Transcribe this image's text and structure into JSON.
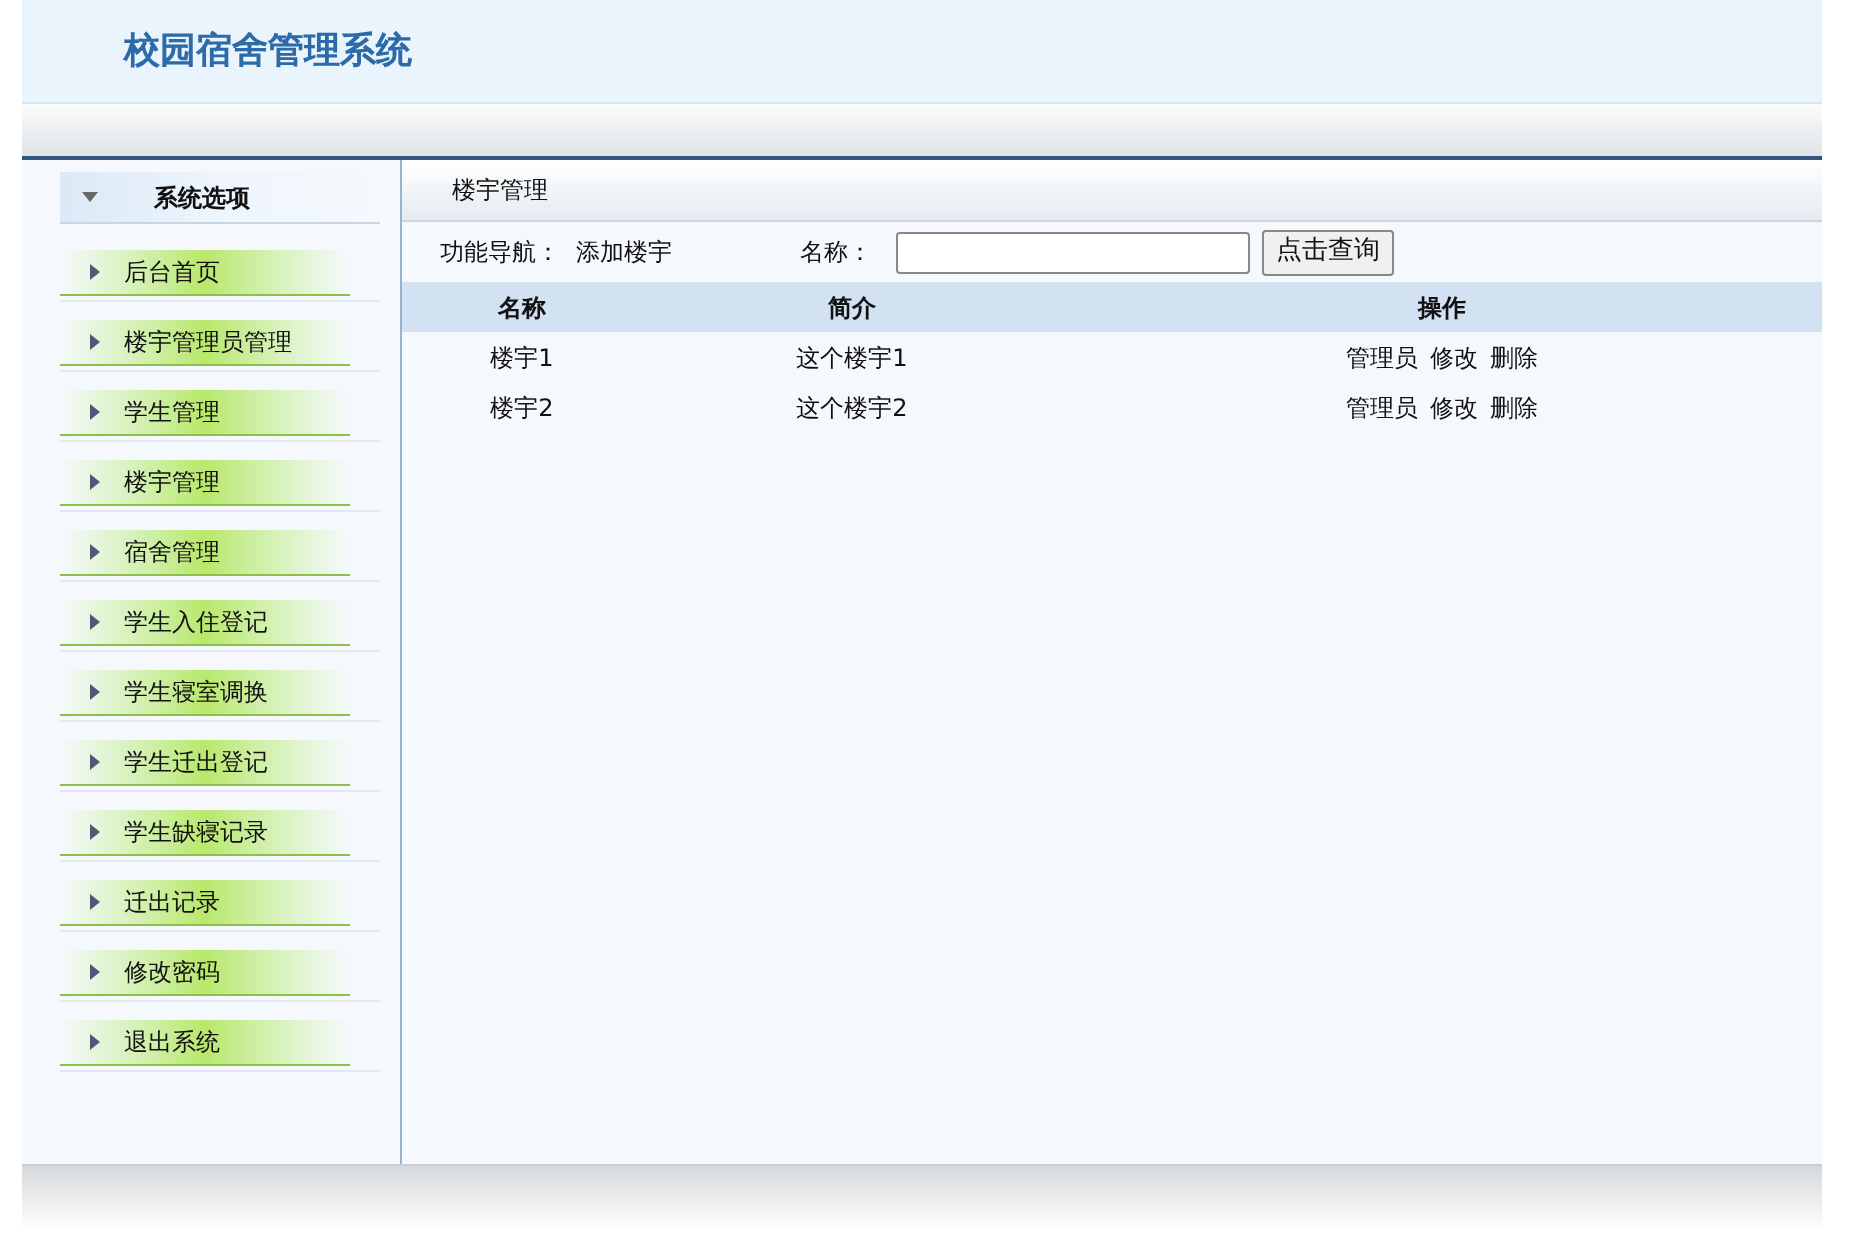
{
  "header": {
    "title": "校园宿舍管理系统"
  },
  "sidebar": {
    "title": "系统选项",
    "items": [
      {
        "label": "后台首页"
      },
      {
        "label": "楼宇管理员管理"
      },
      {
        "label": "学生管理"
      },
      {
        "label": "楼宇管理"
      },
      {
        "label": "宿舍管理"
      },
      {
        "label": "学生入住登记"
      },
      {
        "label": "学生寝室调换"
      },
      {
        "label": "学生迁出登记"
      },
      {
        "label": "学生缺寝记录"
      },
      {
        "label": "迁出记录"
      },
      {
        "label": "修改密码"
      },
      {
        "label": "退出系统"
      }
    ]
  },
  "main": {
    "title": "楼宇管理",
    "nav_label": "功能导航：",
    "nav_link": "添加楼宇",
    "search_label": "名称：",
    "search_button": "点击查询",
    "table": {
      "columns": [
        "名称",
        "简介",
        "操作"
      ],
      "rows": [
        {
          "name": "楼宇1",
          "intro": "这个楼宇1",
          "actions": [
            "管理员",
            "修改",
            "删除"
          ]
        },
        {
          "name": "楼宇2",
          "intro": "这个楼宇2",
          "actions": [
            "管理员",
            "修改",
            "删除"
          ]
        }
      ]
    }
  }
}
